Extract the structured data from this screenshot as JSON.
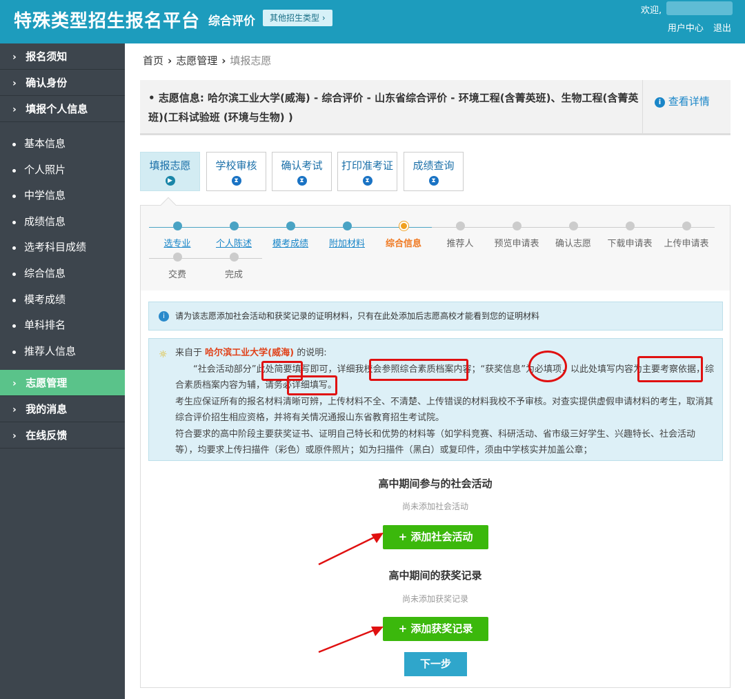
{
  "header": {
    "title": "特殊类型招生报名平台",
    "type": "综合评价",
    "other_type": "其他招生类型",
    "welcome": "欢迎,",
    "user_center": "用户中心",
    "logout": "退出"
  },
  "sidebar": {
    "top_items": [
      "报名须知",
      "确认身份",
      "填报个人信息"
    ],
    "sub_items": [
      "基本信息",
      "个人照片",
      "中学信息",
      "成绩信息",
      "选考科目成绩",
      "综合信息",
      "模考成绩",
      "单科排名",
      "推荐人信息"
    ],
    "bottom_items": [
      "志愿管理",
      "我的消息",
      "在线反馈"
    ]
  },
  "breadcrumb": {
    "home": "首页",
    "level2": "志愿管理",
    "current": "填报志愿"
  },
  "info": {
    "text": "志愿信息: 哈尔滨工业大学(威海) - 综合评价 - 山东省综合评价 - 环境工程(含菁英班)、生物工程(含菁英班)(工科试验班 (环境与生物) )",
    "detail": "查看详情"
  },
  "tabs": [
    "填报志愿",
    "学校审核",
    "确认考试",
    "打印准考证",
    "成绩查询"
  ],
  "steps": [
    "选专业",
    "个人陈述",
    "模考成绩",
    "附加材料",
    "综合信息",
    "推荐人",
    "预览申请表",
    "确认志愿",
    "下载申请表",
    "上传申请表",
    "交费",
    "完成"
  ],
  "tip1": "请为该志愿添加社会活动和获奖记录的证明材料，只有在此处添加后志愿高校才能看到您的证明材料",
  "tip2": {
    "from": "来自于",
    "school": "哈尔滨工业大学(威海)",
    "suffix": "的说明:",
    "p1": "“社会活动部分”此处简要填写即可，详细我校会参照综合素质档案内容；“获奖信息”为必填项，以此处填写内容为主要考察依据，综合素质档案内容为辅，请务必详细填写。",
    "p2": "考生应保证所有的报名材料清晰可辨，上传材料不全、不清楚、上传错误的材料我校不予审核。对查实提供虚假申请材料的考生，取消其综合评价招生相应资格，并将有关情况通报山东省教育招生考试院。",
    "p3": "符合要求的高中阶段主要获奖证书、证明自己特长和优势的材料等（如学科竞赛、科研活动、省市级三好学生、兴趣特长、社会活动等），均要求上传扫描件（彩色）或原件照片；如为扫描件（黑白）或复印件，须由中学核实并加盖公章；"
  },
  "social": {
    "title": "高中期间参与的社会活动",
    "empty": "尚未添加社会活动",
    "button": "+ 添加社会活动"
  },
  "awards": {
    "title": "高中期间的获奖记录",
    "empty": "尚未添加获奖记录",
    "button": "+ 添加获奖记录"
  },
  "next": "下一步",
  "colors": {
    "header": "#1d9cbd",
    "sidebar": "#3d454d",
    "active": "#5ac38a",
    "green_button": "#3bb80c",
    "highlight": "#e01010"
  }
}
